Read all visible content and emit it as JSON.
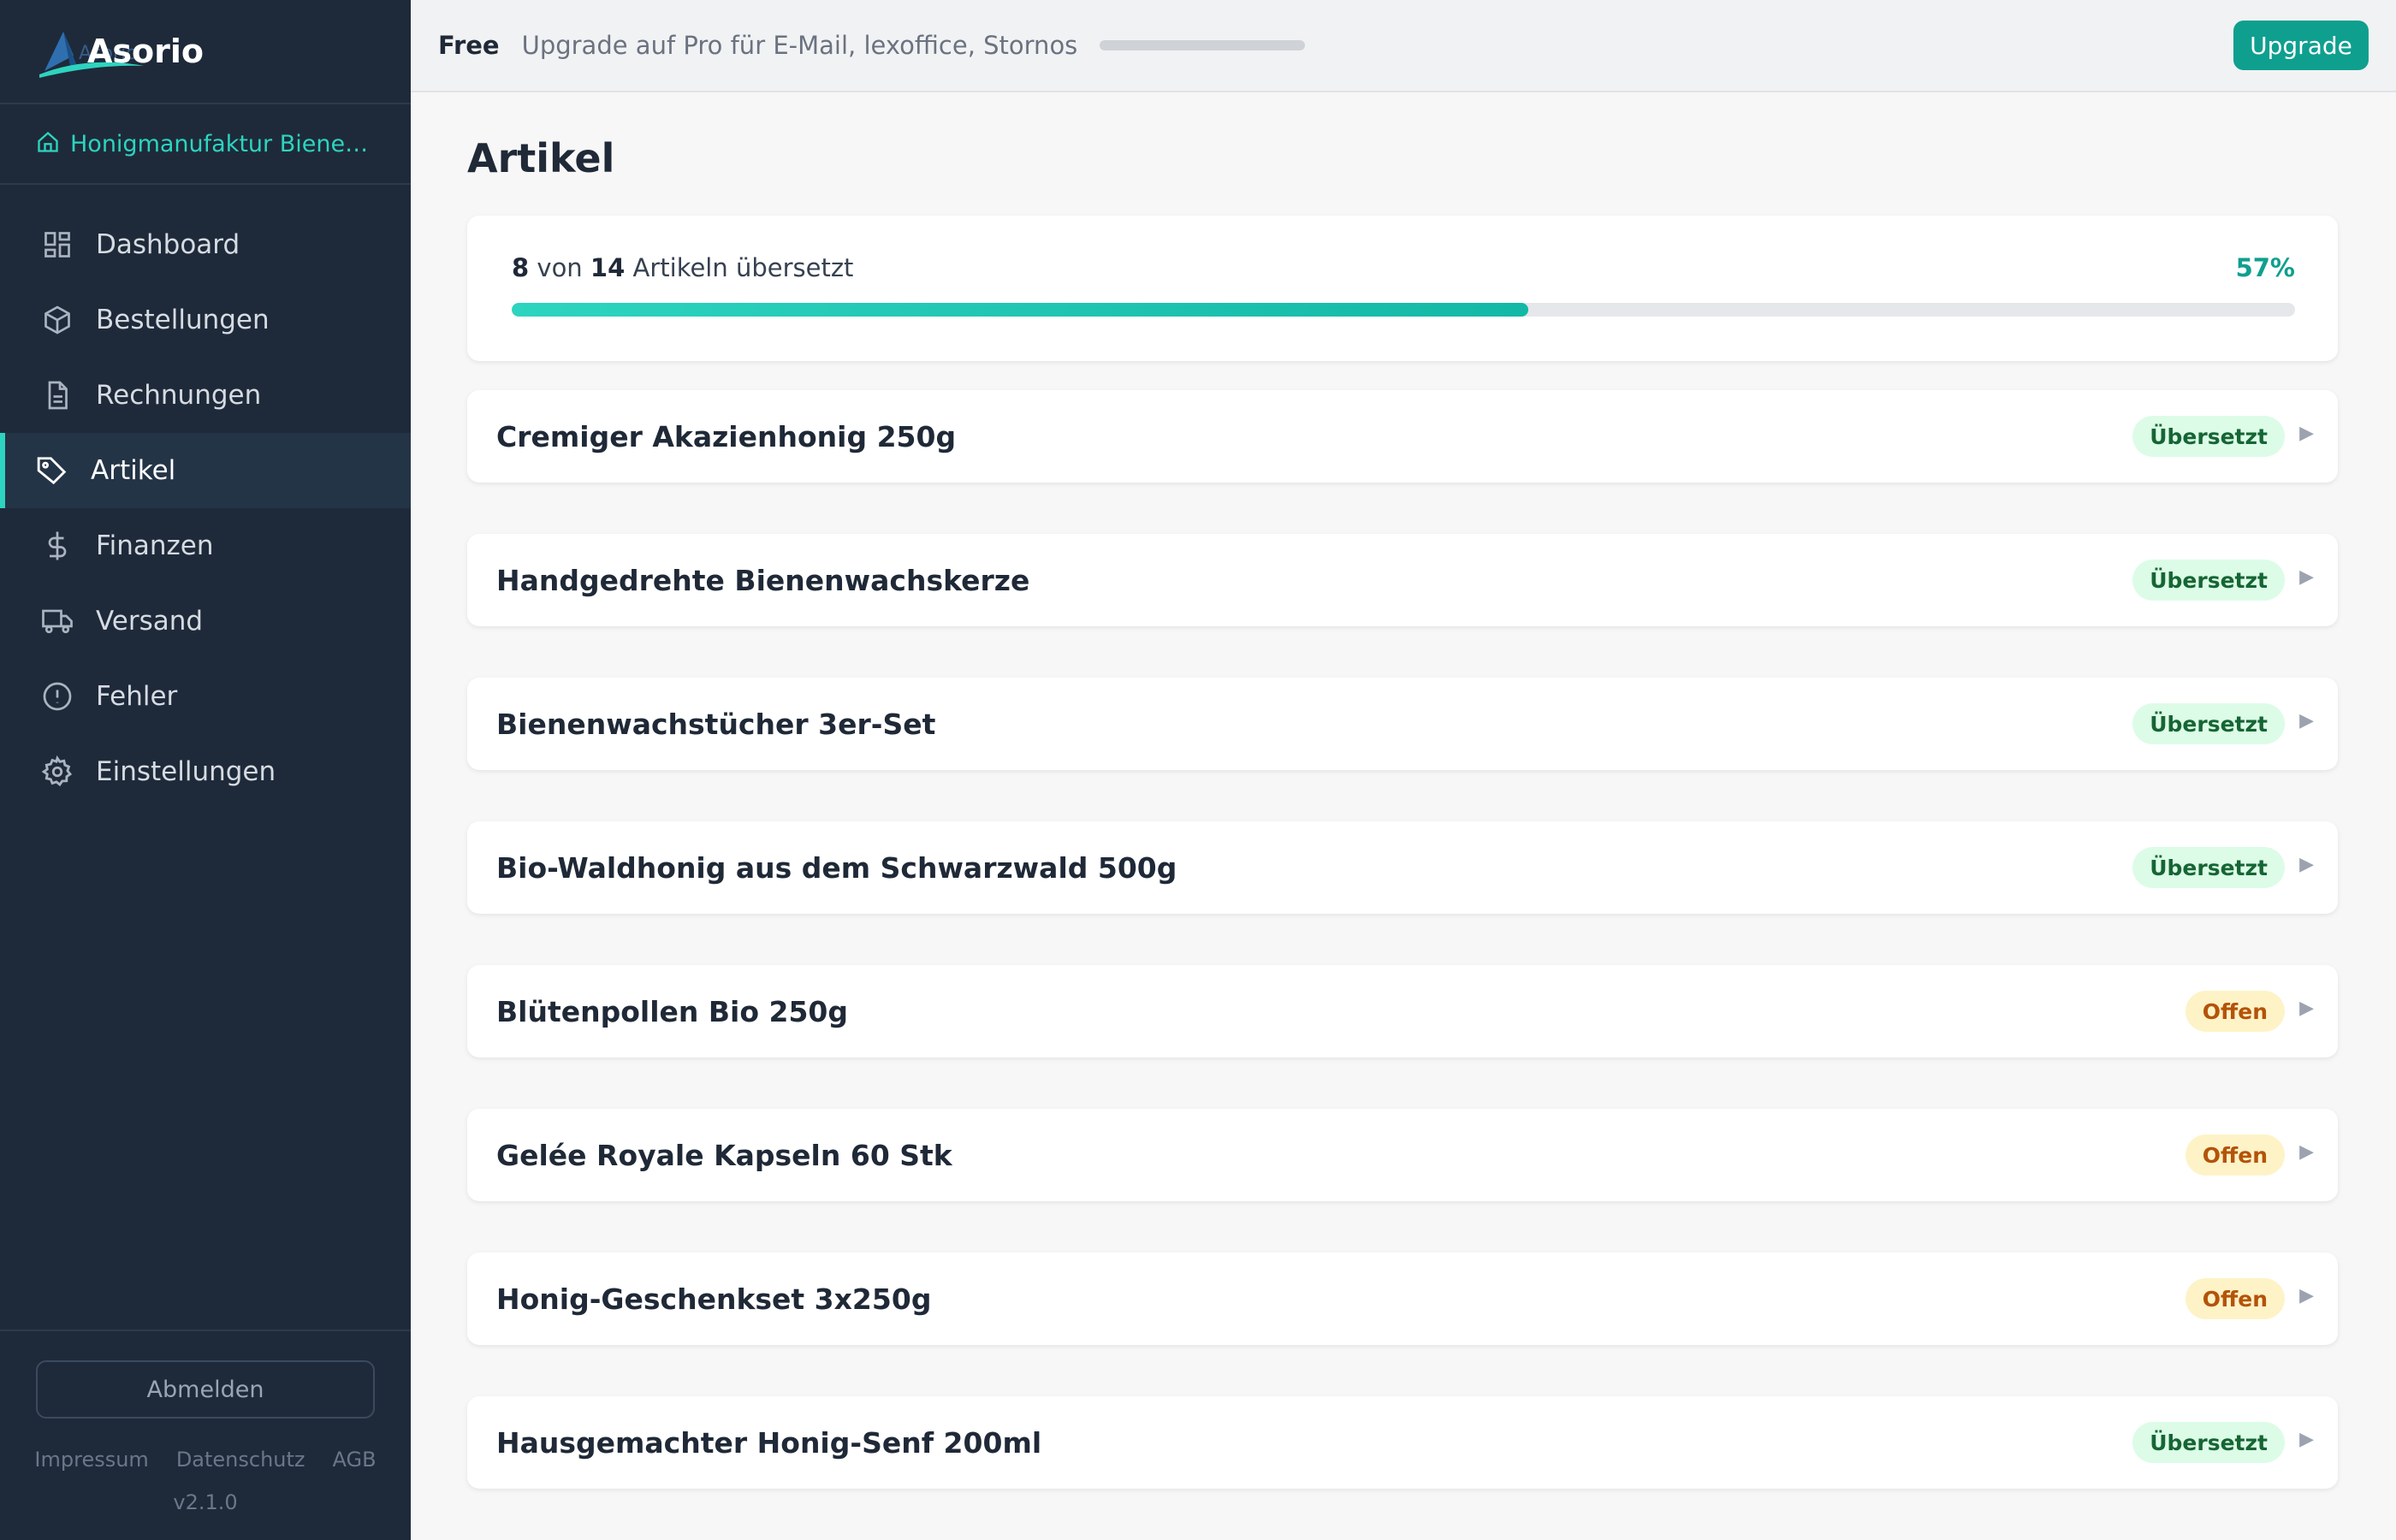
{
  "app": {
    "name": "Asorio",
    "workspace": "Honigmanufaktur Bienenglück",
    "logo_wordmark": "Asorio"
  },
  "nav": {
    "items": [
      {
        "label": "Dashboard",
        "icon": "dashboard-icon"
      },
      {
        "label": "Bestellungen",
        "icon": "box-icon"
      },
      {
        "label": "Rechnungen",
        "icon": "document-icon"
      },
      {
        "label": "Artikel",
        "icon": "tag-icon"
      },
      {
        "label": "Finanzen",
        "icon": "dollar-icon"
      },
      {
        "label": "Versand",
        "icon": "truck-icon"
      },
      {
        "label": "Fehler",
        "icon": "alert-icon"
      },
      {
        "label": "Einstellungen",
        "icon": "gear-icon"
      }
    ],
    "active": "Artikel"
  },
  "footer": {
    "logout": "Abmelden",
    "links": [
      "Impressum",
      "Datenschutz",
      "AGB"
    ],
    "version": "v2.1.0"
  },
  "topbar": {
    "plan": "Free",
    "note": "Upgrade auf Pro für E-Mail, lexoffice, Stornos",
    "upgrade_label": "Upgrade"
  },
  "page": {
    "title": "Artikel",
    "progress": {
      "done": "8",
      "mid": "von",
      "total": "14",
      "suffix": "Artikeln übersetzt",
      "percent_label": "57%",
      "fraction": 0.57
    }
  },
  "items": [
    {
      "name": "Cremiger Akazienhonig 250g",
      "status": "Übersetzt",
      "state": "done"
    },
    {
      "name": "Handgedrehte Bienenwachskerze",
      "status": "Übersetzt",
      "state": "done"
    },
    {
      "name": "Bienenwachstücher 3er-Set",
      "status": "Übersetzt",
      "state": "done"
    },
    {
      "name": "Bio-Waldhonig aus dem Schwarzwald 500g",
      "status": "Übersetzt",
      "state": "done"
    },
    {
      "name": "Blütenpollen Bio 250g",
      "status": "Offen",
      "state": "open"
    },
    {
      "name": "Gelée Royale Kapseln 60 Stk",
      "status": "Offen",
      "state": "open"
    },
    {
      "name": "Honig-Geschenkset 3x250g",
      "status": "Offen",
      "state": "open"
    },
    {
      "name": "Hausgemachter Honig-Senf 200ml",
      "status": "Übersetzt",
      "state": "done"
    }
  ],
  "colors": {
    "accent": "#0f9f8f",
    "sidebar": "#1e2a3a",
    "done_badge": "#dcfce7",
    "open_badge": "#fef3c7"
  }
}
